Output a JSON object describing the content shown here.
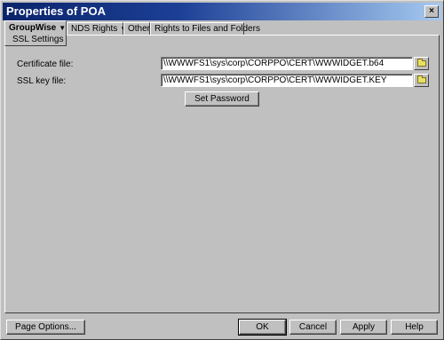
{
  "window": {
    "title": "Properties of POA",
    "close_glyph": "×"
  },
  "tabs": [
    {
      "label": "GroupWise",
      "has_menu": true,
      "active": true
    },
    {
      "label": "NDS Rights",
      "has_menu": true,
      "active": false
    },
    {
      "label": "Other",
      "has_menu": false,
      "active": false
    },
    {
      "label": "Rights to Files and Folders",
      "has_menu": false,
      "active": false
    }
  ],
  "subtab": {
    "label": "SSL Settings"
  },
  "form": {
    "certificate_label": "Certificate file:",
    "certificate_value": "\\\\WWWFS1\\sys\\corp\\CORPPO\\CERT\\WWWIDGET.b64",
    "ssl_key_label": "SSL key file:",
    "ssl_key_value": "\\\\WWWFS1\\sys\\corp\\CORPPO\\CERT\\WWWIDGET.KEY",
    "set_password_label": "Set Password"
  },
  "footer": {
    "page_options": "Page Options...",
    "ok": "OK",
    "cancel": "Cancel",
    "apply": "Apply",
    "help": "Help"
  },
  "icons": {
    "menu_arrow": "chevron-down-icon",
    "browse": "folder-icon"
  }
}
